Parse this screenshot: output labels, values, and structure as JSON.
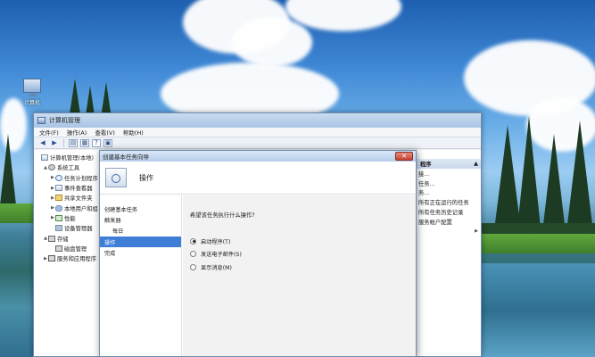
{
  "desktop": {
    "icon_label": "计算机"
  },
  "cm_window": {
    "title": "计算机管理",
    "menu": [
      "文件(F)",
      "操作(A)",
      "查看(V)",
      "帮助(H)"
    ],
    "toolbar_icons": [
      "back-arrow-icon",
      "forward-arrow-icon",
      "up-folder-icon",
      "properties-icon",
      "help-icon",
      "show-hide-icon"
    ],
    "tree": [
      {
        "label": "计算机管理(本地)",
        "level": 0,
        "arrow": "",
        "icon": "computer"
      },
      {
        "label": "系统工具",
        "level": 1,
        "arrow": "▲",
        "icon": "gear"
      },
      {
        "label": "任务计划程序",
        "level": 2,
        "arrow": "▶",
        "icon": "clock"
      },
      {
        "label": "事件查看器",
        "level": 2,
        "arrow": "▶",
        "icon": "computer"
      },
      {
        "label": "共享文件夹",
        "level": 2,
        "arrow": "▶",
        "icon": "folder"
      },
      {
        "label": "本地用户和组",
        "level": 2,
        "arrow": "▶",
        "icon": "users"
      },
      {
        "label": "性能",
        "level": 2,
        "arrow": "▶",
        "icon": "chart"
      },
      {
        "label": "设备管理器",
        "level": 2,
        "arrow": "",
        "icon": "device"
      },
      {
        "label": "存储",
        "level": 1,
        "arrow": "▲",
        "icon": "disk"
      },
      {
        "label": "磁盘管理",
        "level": 2,
        "arrow": "",
        "icon": "disk"
      },
      {
        "label": "服务和应用程序",
        "level": 1,
        "arrow": "▶",
        "icon": "service"
      }
    ],
    "actions": {
      "header": "程序",
      "header_arrow": "▲",
      "items": [
        {
          "label": "接...",
          "arrow": ""
        },
        {
          "label": "任务...",
          "arrow": ""
        },
        {
          "label": "务...",
          "arrow": ""
        },
        {
          "label": "所有正在运行的任务",
          "arrow": ""
        },
        {
          "label": "所有任务历史记录",
          "arrow": ""
        },
        {
          "label": "服务帐户配置",
          "arrow": ""
        },
        {
          "label": "",
          "arrow": "▶"
        }
      ]
    }
  },
  "wizard": {
    "title": "创建基本任务向导",
    "close_glyph": "✕",
    "header_title": "操作",
    "steps": [
      {
        "label": "创建基本任务",
        "indent": false,
        "active": false
      },
      {
        "label": "触发器",
        "indent": false,
        "active": false
      },
      {
        "label": "每日",
        "indent": true,
        "active": false
      },
      {
        "label": "操作",
        "indent": false,
        "active": true
      },
      {
        "label": "完成",
        "indent": false,
        "active": false
      }
    ],
    "question": "希望该任务执行什么操作?",
    "options": [
      {
        "label": "启动程序(T)",
        "checked": true
      },
      {
        "label": "发送电子邮件(S)",
        "checked": false
      },
      {
        "label": "显示消息(M)",
        "checked": false
      }
    ]
  }
}
